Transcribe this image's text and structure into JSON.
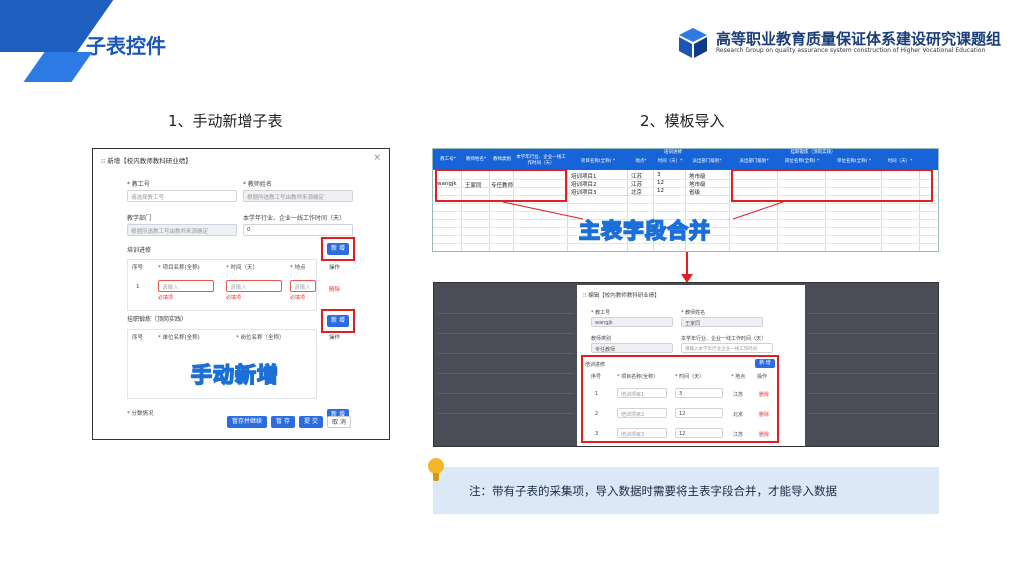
{
  "slide": {
    "title": "子表控件",
    "logo": {
      "main": "高等职业教育质量保证体系建设研究课题组",
      "sub": "Research Group on quality assurance system construction of Higher Vocational Education"
    },
    "section_manual": "1、手动新增子表",
    "section_import": "2、模板导入",
    "overlay_manual": "手动新增",
    "overlay_merge": "主表字段合并",
    "note": "注：带有子表的采集项，导入数据时需要将主表字段合并，才能导入数据",
    "colors": {
      "accent": "#1a56b5",
      "red": "#e02020",
      "note_bg": "#dce8f6"
    }
  },
  "dialog": {
    "title": "⁝⁝ 新增【校内教师教科研业绩】",
    "close": "×",
    "staff_no_label": "* 教工号",
    "staff_no_placeholder": "请选择教工号",
    "teacher_label": "* 教师姓名",
    "teacher_placeholder": "根据所选教工号由教师来源确定",
    "dept_label": "教学部门",
    "dept_value": "根据所选教工号由教师来源确定",
    "hours_label": "本学年行业、企业一线工作时间（天）",
    "hours_value": "0",
    "sub1_title": "培训进修",
    "sub1_add": "新 增",
    "sub1_cols": [
      "序号",
      "* 项目名称(全称)",
      "* 时间（天）",
      "* 地点"
    ],
    "sub1_op": "操作",
    "sub1_row_no": "1",
    "sub1_input1": "请输入",
    "sub1_input2": "请输入",
    "sub1_input3": "请输入",
    "sub1_err1": "必填项",
    "sub1_err2": "必填项",
    "sub1_err3": "必填项",
    "sub1_delete": "删除",
    "sub2_title": "挂职锻炼（顶岗实践）",
    "sub2_add": "新 增",
    "sub2_cols": [
      "序号",
      "* 单位名称(全称)",
      "* 岗位名称（全称）"
    ],
    "sub2_op": "操作",
    "footer_label": "* 分数情况",
    "footer_add": "新 增",
    "btn_save_draft": "暂存并继续",
    "btn_save": "暂 存",
    "btn_submit": "提 交",
    "btn_cancel": "取 消"
  },
  "sheet": {
    "group1": "培训进修",
    "group2": "挂职锻炼（顶岗实践）",
    "headers": [
      "教工号*",
      "教师姓名*",
      "教师类别",
      "本学年行业、企业一线工作时间（天）",
      "项目名称(全称) *",
      "地点*",
      "时间（天）*",
      "派出部门级别*",
      "派出部门级别*",
      "岗位名称(全称) *",
      "单位名称(全称) *",
      "时间（天）*"
    ],
    "main_row": {
      "staff_no": "wangjk",
      "name": "王家同",
      "category": "专任教师"
    },
    "rows": [
      {
        "project": "培训项目1",
        "place": "江苏",
        "days": "3",
        "level": "地市级"
      },
      {
        "project": "培训项目2",
        "place": "江苏",
        "days": "12",
        "level": "地市级"
      },
      {
        "project": "培训项目3",
        "place": "北京",
        "days": "12",
        "level": "省级"
      }
    ]
  },
  "shot": {
    "dlg_title": "⁝⁝ 编辑【校内教师教科研业绩】",
    "staff_label": "* 教工号",
    "staff_value": "wangjk",
    "name_label": "* 教师姓名",
    "name_value": "王家同",
    "dept_label": "教师类别",
    "dept_value": "专任教师",
    "hours_label": "本学年行业、企业一线工作时间（天）",
    "hours_value": "请输入本学年行业企业一线工作时间",
    "sub_title": "培训进修",
    "sub_add": "新 增",
    "cols": [
      "序号",
      "* 项目名称(全称)",
      "* 时间（天）",
      "* 地点",
      "操作"
    ],
    "rows": [
      {
        "no": "1",
        "name": "培训项目1",
        "days": "3",
        "place": "江苏",
        "op": "删除"
      },
      {
        "no": "2",
        "name": "培训项目2",
        "days": "12",
        "place": "北京",
        "op": "删除"
      },
      {
        "no": "3",
        "name": "培训项目3",
        "days": "12",
        "place": "江苏",
        "op": "删除"
      }
    ]
  }
}
